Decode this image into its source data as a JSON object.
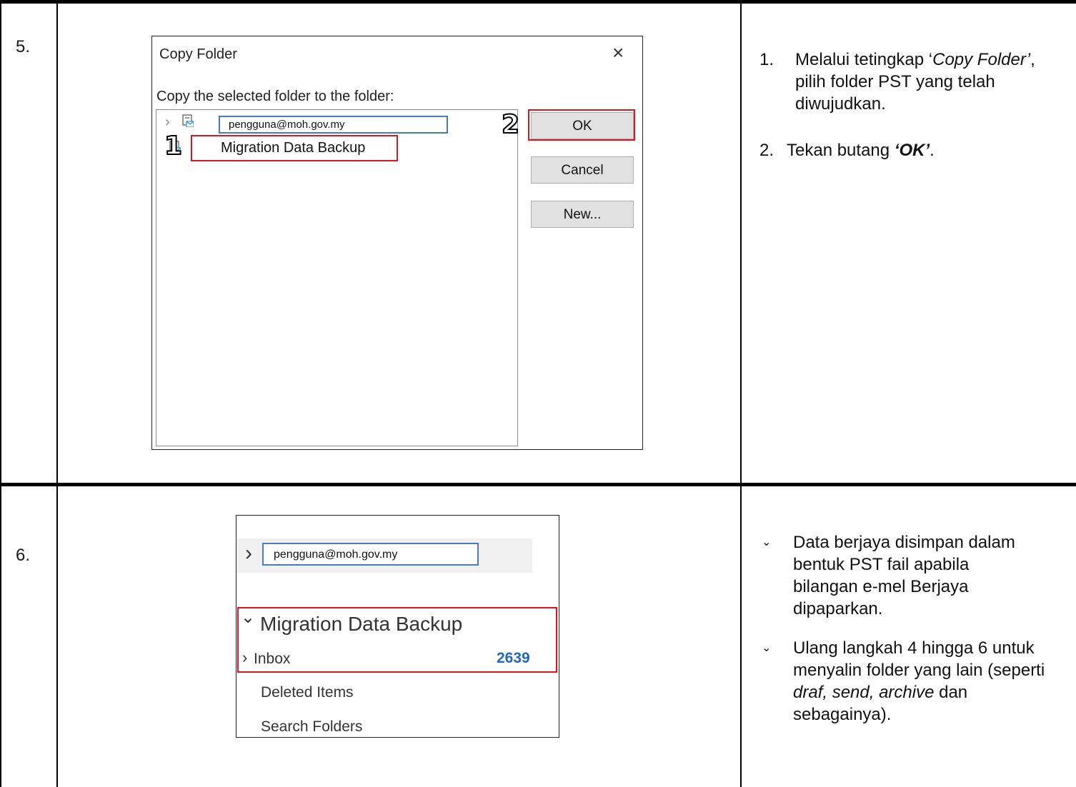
{
  "rows": [
    {
      "number": "5.",
      "dialog": {
        "title": "Copy Folder",
        "close_glyph": "×",
        "label": "Copy the selected folder to the folder:",
        "tree_items": [
          {
            "label": "pengguna@moh.gov.my",
            "icon": "mailbox-icon",
            "expander": "›"
          },
          {
            "label": "Migration Data Backup",
            "icon": "pst-folder-icon"
          }
        ],
        "buttons": {
          "ok": "OK",
          "cancel": "Cancel",
          "new": "New..."
        }
      },
      "markers": {
        "one": "1",
        "two": "2"
      },
      "instructions": {
        "item1_num": "1.",
        "item1_a": "Melalui tetingkap ‘",
        "item1_italic": "Copy Folder’",
        "item1_b": ", pilih folder PST yang telah diwujudkan.",
        "item2_num": "2.",
        "item2_a": "Tekan butang ",
        "item2_bold": "‘OK’",
        "item2_b": "."
      }
    },
    {
      "number": "6.",
      "pane": {
        "account_expander": "›",
        "account": "pengguna@moh.gov.my",
        "folder_expander": "⌄",
        "folder": "Migration Data Backup",
        "inbox_expander": "›",
        "inbox": "Inbox",
        "inbox_count": "2639",
        "deleted": "Deleted Items",
        "search": "Search Folders"
      },
      "notes": {
        "bullet": "⌄",
        "note1": "Data berjaya disimpan dalam bentuk PST fail apabila bilangan e-mel Berjaya dipaparkan.",
        "note2_a": "Ulang langkah 4 hingga 6 untuk menyalin folder yang lain (seperti ",
        "note2_italic": "draf, send, archive",
        "note2_b": " dan sebagainya)."
      }
    }
  ],
  "colors": {
    "highlight_red": "#e0141e",
    "highlight_blue": "#4a7bbf",
    "count_blue": "#2266c4"
  }
}
